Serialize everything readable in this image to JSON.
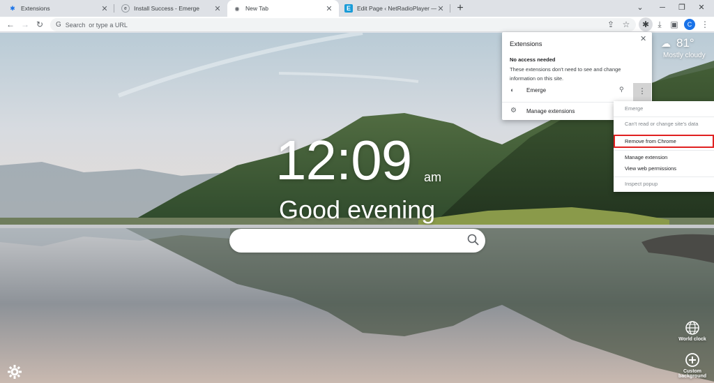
{
  "tabs": [
    {
      "title": "Extensions",
      "icon": "puzzle-icon"
    },
    {
      "title": "Install Success - Emerge",
      "icon": "emerge-icon"
    },
    {
      "title": "New Tab",
      "icon": "newtab-icon"
    },
    {
      "title": "Edit Page ‹ NetRadioPlayer — W",
      "icon": "e-icon"
    }
  ],
  "omnibox": {
    "placeholder": "Search  or type a URL"
  },
  "profile": {
    "initial": "C"
  },
  "newtab_page": {
    "time": "12:09",
    "ampm": "am",
    "greeting": "Good evening",
    "weather": {
      "temp": "81°",
      "condition": "Mostly cloudy"
    },
    "world_clock_label": "World clock",
    "custom_background_label": "Custom background"
  },
  "extensions_popup": {
    "title": "Extensions",
    "section_title": "No access needed",
    "section_desc": "These extensions don't need to see and change information on this site.",
    "extension_name": "Emerge",
    "manage_label": "Manage extensions"
  },
  "context_menu": {
    "items": [
      {
        "label": "Emerge",
        "disabled": true
      },
      {
        "label": "Can't read or change site's data",
        "disabled": true
      },
      {
        "label": "Remove from Chrome",
        "disabled": false,
        "highlighted": true
      },
      {
        "label": "Manage extension",
        "disabled": false
      },
      {
        "label": "View web permissions",
        "disabled": false
      },
      {
        "label": "Inspect popup",
        "disabled": true
      }
    ]
  },
  "colors": {
    "highlight_border": "#e02020",
    "profile_avatar": "#1a73e8",
    "tab_strip": "#dee1e6"
  }
}
